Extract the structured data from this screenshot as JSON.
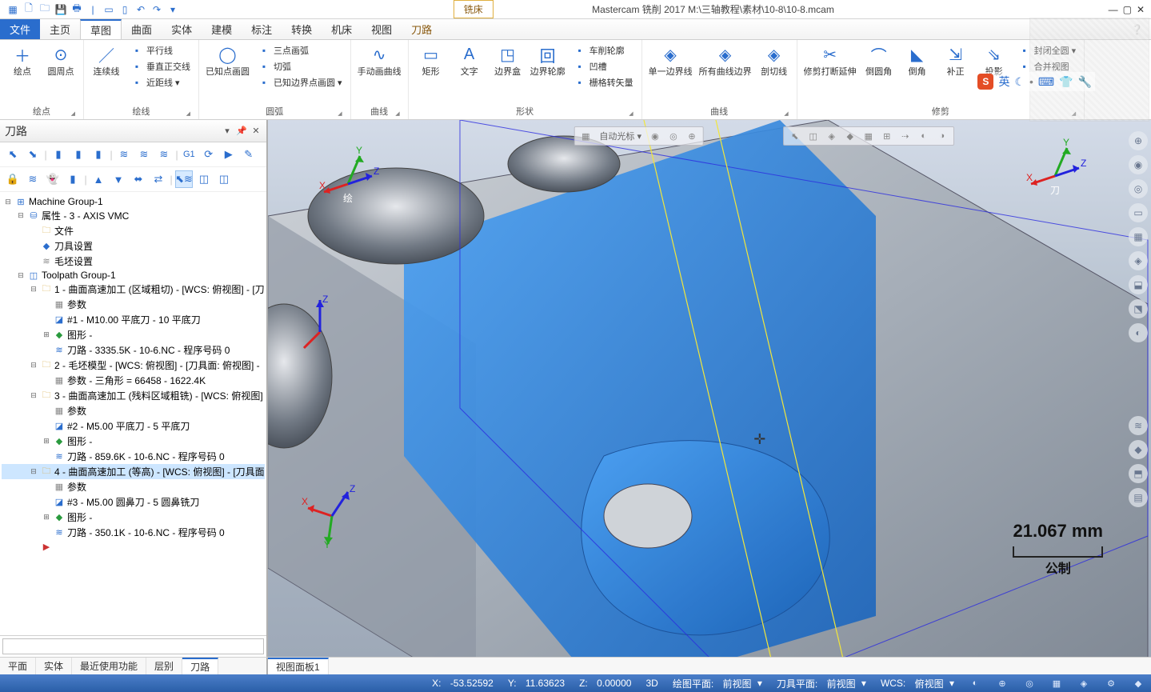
{
  "title": "Mastercam 铣削 2017  M:\\三轴教程\\素材\\10-8\\10-8.mcam",
  "mill_tab": "铣床",
  "tabs": {
    "file": "文件",
    "items": [
      "主页",
      "草图",
      "曲面",
      "实体",
      "建模",
      "标注",
      "转换",
      "机床",
      "视图",
      "刀路"
    ],
    "active_index": 1,
    "golden_index": 9
  },
  "ribbon": {
    "groups": [
      {
        "label": "绘点",
        "big": [
          {
            "icon": "＋",
            "text": "绘点"
          },
          {
            "icon": "⊙",
            "text": "圆周点"
          }
        ]
      },
      {
        "label": "绘线",
        "big": [
          {
            "icon": "／",
            "text": "连续线"
          }
        ],
        "small": [
          "平行线",
          "垂直正交线",
          "近距线 ▾"
        ]
      },
      {
        "label": "圆弧",
        "big": [
          {
            "icon": "◯",
            "text": "已知点画圆"
          }
        ],
        "small": [
          "三点画弧",
          "切弧",
          "已知边界点画圆 ▾"
        ]
      },
      {
        "label": "曲线",
        "big": [
          {
            "icon": "∿",
            "text": "手动画曲线"
          }
        ]
      },
      {
        "label": "形状",
        "big": [
          {
            "icon": "▭",
            "text": "矩形"
          },
          {
            "icon": "A",
            "text": "文字"
          },
          {
            "icon": "◳",
            "text": "边界盒"
          },
          {
            "icon": "回",
            "text": "边界轮廓"
          }
        ],
        "small": [
          "车削轮廓",
          "凹槽",
          "栅格转矢量"
        ]
      },
      {
        "label": "曲线",
        "big": [
          {
            "icon": "◈",
            "text": "单一边界线"
          },
          {
            "icon": "◈",
            "text": "所有曲线边界"
          },
          {
            "icon": "◈",
            "text": "剖切线"
          }
        ]
      },
      {
        "label": "修剪",
        "big": [
          {
            "icon": "✂",
            "text": "修剪打断延伸"
          },
          {
            "icon": "⌒",
            "text": "倒圆角"
          },
          {
            "icon": "◣",
            "text": "倒角"
          },
          {
            "icon": "⇲",
            "text": "补正"
          },
          {
            "icon": "⇘",
            "text": "投影"
          }
        ],
        "small": [
          "封闭全圆 ▾",
          "合并视图"
        ]
      }
    ]
  },
  "panel": {
    "title": "刀路",
    "bottom_tabs_left": [
      "平面",
      "实体",
      "最近使用功能",
      "层别",
      "刀路"
    ],
    "bottom_tabs_left_active": 4,
    "bottom_tabs_right": [
      "视图面板1"
    ],
    "bottom_tabs_right_active": 0
  },
  "tree": [
    {
      "lv": 0,
      "exp": "⊟",
      "icon": "⊞",
      "iclass": "i-blue",
      "text": "Machine Group-1"
    },
    {
      "lv": 1,
      "exp": "⊟",
      "icon": "⛁",
      "iclass": "i-blue",
      "text": "属性 - 3 - AXIS VMC"
    },
    {
      "lv": 2,
      "exp": "",
      "icon": "🗀",
      "iclass": "i-folder",
      "text": "文件"
    },
    {
      "lv": 2,
      "exp": "",
      "icon": "◆",
      "iclass": "i-blue",
      "text": "刀具设置"
    },
    {
      "lv": 2,
      "exp": "",
      "icon": "≋",
      "iclass": "i-gray",
      "text": "毛坯设置"
    },
    {
      "lv": 1,
      "exp": "⊟",
      "icon": "◫",
      "iclass": "i-blue",
      "text": "Toolpath Group-1"
    },
    {
      "lv": 2,
      "exp": "⊟",
      "icon": "🗀",
      "iclass": "i-folder",
      "text": "1 - 曲面高速加工 (区域粗切) - [WCS: 俯视图] - [刀"
    },
    {
      "lv": 3,
      "exp": "",
      "icon": "▦",
      "iclass": "i-gray",
      "text": "参数"
    },
    {
      "lv": 3,
      "exp": "",
      "icon": "◪",
      "iclass": "i-blue",
      "text": "#1 - M10.00 平底刀 - 10 平底刀"
    },
    {
      "lv": 3,
      "exp": "⊞",
      "icon": "◆",
      "iclass": "i-green",
      "text": "图形 -"
    },
    {
      "lv": 3,
      "exp": "",
      "icon": "≋",
      "iclass": "i-blue",
      "text": "刀路 - 3335.5K - 10-6.NC - 程序号码 0"
    },
    {
      "lv": 2,
      "exp": "⊟",
      "icon": "🗀",
      "iclass": "i-folder",
      "text": "2 - 毛坯模型 - [WCS: 俯视图] - [刀具面: 俯视图] -"
    },
    {
      "lv": 3,
      "exp": "",
      "icon": "▦",
      "iclass": "i-gray",
      "text": "参数 - 三角形 =  66458 - 1622.4K"
    },
    {
      "lv": 2,
      "exp": "⊟",
      "icon": "🗀",
      "iclass": "i-folder",
      "text": "3 - 曲面高速加工 (残料区域粗铣) - [WCS: 俯视图]"
    },
    {
      "lv": 3,
      "exp": "",
      "icon": "▦",
      "iclass": "i-gray",
      "text": "参数"
    },
    {
      "lv": 3,
      "exp": "",
      "icon": "◪",
      "iclass": "i-blue",
      "text": "#2 - M5.00 平底刀 - 5 平底刀"
    },
    {
      "lv": 3,
      "exp": "⊞",
      "icon": "◆",
      "iclass": "i-green",
      "text": "图形 -"
    },
    {
      "lv": 3,
      "exp": "",
      "icon": "≋",
      "iclass": "i-blue",
      "text": "刀路 - 859.6K - 10-6.NC - 程序号码 0"
    },
    {
      "lv": 2,
      "exp": "⊟",
      "icon": "🗀",
      "iclass": "i-folder",
      "text": "4 - 曲面高速加工 (等高) - [WCS: 俯视图] - [刀具面",
      "selected": true
    },
    {
      "lv": 3,
      "exp": "",
      "icon": "▦",
      "iclass": "i-gray",
      "text": "参数"
    },
    {
      "lv": 3,
      "exp": "",
      "icon": "◪",
      "iclass": "i-blue",
      "text": "#3 - M5.00 圆鼻刀 - 5 圆鼻铣刀"
    },
    {
      "lv": 3,
      "exp": "⊞",
      "icon": "◆",
      "iclass": "i-green",
      "text": "图形 -"
    },
    {
      "lv": 3,
      "exp": "",
      "icon": "≋",
      "iclass": "i-blue",
      "text": "刀路 - 350.1K - 10-6.NC - 程序号码 0"
    },
    {
      "lv": 2,
      "exp": "",
      "icon": "▶",
      "iclass": "i-red",
      "text": ""
    }
  ],
  "viewport": {
    "scale_value": "21.067 mm",
    "scale_unit": "公制",
    "gnomon_labels": {
      "x": "X",
      "y": "Y",
      "z": "Z",
      "draw": "绘",
      "tool": "刀"
    }
  },
  "status": {
    "x_label": "X:",
    "x": "-53.52592",
    "y_label": "Y:",
    "y": "11.63623",
    "z_label": "Z:",
    "z": "0.00000",
    "mode": "3D",
    "cplane_label": "绘图平面:",
    "cplane": "前视图",
    "tplane_label": "刀具平面:",
    "tplane": "前视图",
    "wcs_label": "WCS:",
    "wcs": "俯视图"
  },
  "ime": {
    "s": "S",
    "lang": "英",
    "moon": "☾"
  }
}
